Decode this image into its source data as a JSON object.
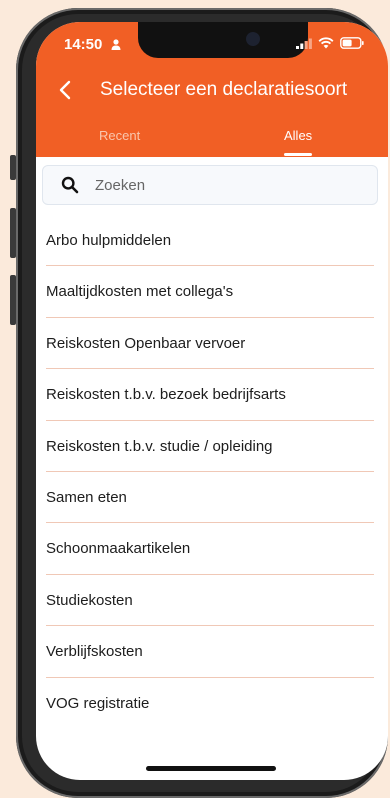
{
  "status_bar": {
    "time": "14:50"
  },
  "header": {
    "title": "Selecteer een declaratiesoort",
    "tabs": [
      {
        "label": "Recent",
        "active": false
      },
      {
        "label": "Alles",
        "active": true
      }
    ]
  },
  "search": {
    "placeholder": "Zoeken",
    "value": ""
  },
  "list": {
    "items": [
      "Arbo hulpmiddelen",
      "Maaltijdkosten met collega's",
      "Reiskosten Openbaar vervoer",
      "Reiskosten t.b.v. bezoek bedrijfsarts",
      "Reiskosten t.b.v. studie / opleiding",
      "Samen eten",
      "Schoonmaakartikelen",
      "Studiekosten",
      "Verblijfskosten",
      "VOG registratie"
    ]
  },
  "colors": {
    "accent": "#f15f25",
    "divider": "#f0c8b6",
    "background": "#fbeadb"
  }
}
